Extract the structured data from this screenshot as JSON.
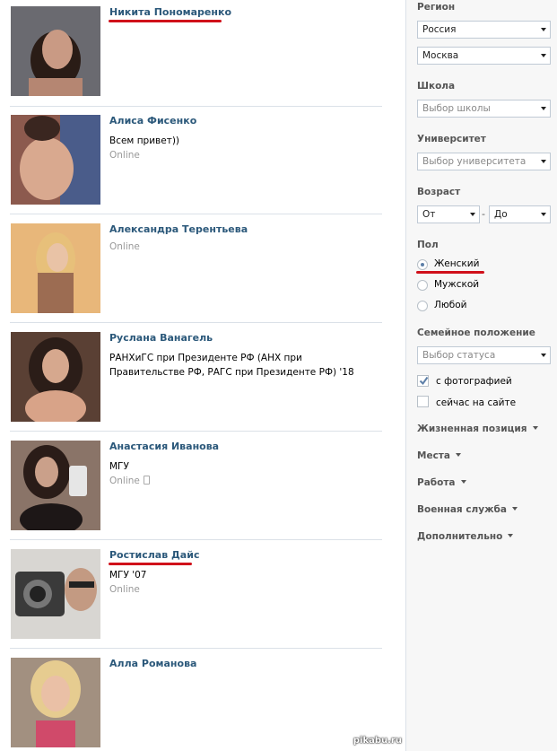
{
  "results": [
    {
      "name": "Никита Пономаренко",
      "info": "",
      "status": ""
    },
    {
      "name": "Алиса Фисенко",
      "info": "Всем привет))",
      "status": "Online"
    },
    {
      "name": "Александра Терентьева",
      "info": "",
      "status": "Online"
    },
    {
      "name": "Руслана Ванагель",
      "info": "РАНХиГС при Президенте РФ (АНХ при Правительстве РФ, РАГС при Президенте РФ) '18",
      "status": ""
    },
    {
      "name": "Анастасия Иванова",
      "info": "МГУ",
      "status": "Online"
    },
    {
      "name": "Ростислав Дайс",
      "info": "МГУ '07",
      "status": "Online"
    },
    {
      "name": "Алла Романова",
      "info": "",
      "status": ""
    }
  ],
  "filters": {
    "region_label": "Регион",
    "country": "Россия",
    "city": "Москва",
    "school_label": "Школа",
    "school_placeholder": "Выбор школы",
    "university_label": "Университет",
    "university_placeholder": "Выбор университета",
    "age_label": "Возраст",
    "age_from": "От",
    "age_dash": "-",
    "age_to": "До",
    "sex_label": "Пол",
    "sex_options": [
      "Женский",
      "Мужской",
      "Любой"
    ],
    "sex_selected": "Женский",
    "marital_label": "Семейное положение",
    "marital_placeholder": "Выбор статуса",
    "with_photo": "с фотографией",
    "with_photo_checked": true,
    "online_now": "сейчас на сайте",
    "online_now_checked": false,
    "sections": [
      "Жизненная позиция",
      "Места",
      "Работа",
      "Военная служба",
      "Дополнительно"
    ]
  },
  "watermark": "pikabu.ru",
  "colors": {
    "link": "#2b587a",
    "underline": "#d0101a",
    "sidebar_bg": "#f7f7f7"
  }
}
